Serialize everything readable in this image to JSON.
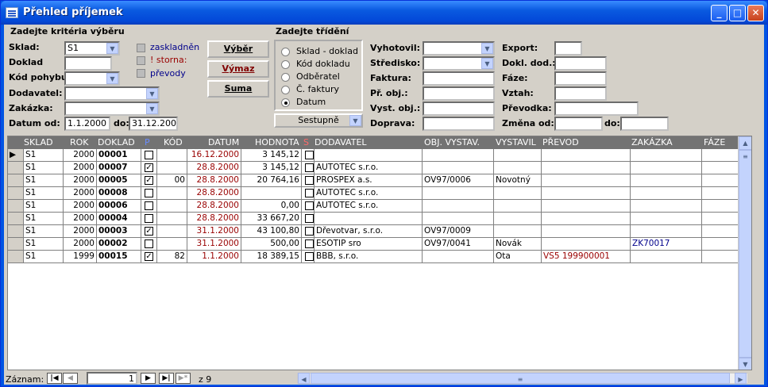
{
  "window": {
    "title": "Přehled příjemek"
  },
  "filter": {
    "group_title": "Zadejte kritéria výběru",
    "sklad_label": "Sklad:",
    "sklad_value": "S1",
    "doklad_label": "Doklad",
    "doklad_value": "",
    "kod_label": "Kód pohybu:",
    "kod_value": "",
    "dodavatel_label": "Dodavatel:",
    "dodavatel_value": "",
    "zakazka_label": "Zakázka:",
    "zakazka_value": "",
    "datum_label": "Datum od:",
    "datum_od": "1.1.2000",
    "do_label": "do:",
    "datum_do": "31.12.2000",
    "check_naskladnen": "zaskladněn",
    "check_storna": "! storna:",
    "check_prevody": "převody"
  },
  "buttons": {
    "vyber": "Výběr",
    "vymaz": "Výmaz",
    "suma": "Suma"
  },
  "sort": {
    "group_title": "Zadejte třídění",
    "options": [
      "Sklad - doklad",
      "Kód dokladu",
      "Odběratel",
      "Č. faktury",
      "Datum"
    ],
    "selected": 4,
    "direction": "Sestupně"
  },
  "filter2": {
    "vyhotovil": "Vyhotovil:",
    "stredisko": "Středisko:",
    "faktura": "Faktura:",
    "pr_obj": "Př. obj.:",
    "vyst_obj": "Vyst. obj.:",
    "doprava": "Doprava:",
    "export": "Export:",
    "dokl_dod": "Dokl. dod.:",
    "faze": "Fáze:",
    "vztah": "Vztah:",
    "prevodka": "Převodka:",
    "zmena_od": "Změna od:",
    "do": "do:"
  },
  "table": {
    "headers": [
      "SKLAD",
      "ROK",
      "DOKLAD",
      "P",
      "KÓD",
      "DATUM",
      "HODNOTA",
      "S",
      "DODAVATEL",
      "OBJ. VYSTAV.",
      "VYSTAVIL",
      "PŘEVOD",
      "ZAKÁZKA",
      "FÁZE"
    ],
    "rows": [
      {
        "sklad": "S1",
        "rok": "2000",
        "doklad": "00001",
        "p": "",
        "kod": "",
        "datum": "16.12.2000",
        "hodnota": "3 145,12",
        "s": "",
        "dodavatel": "",
        "obj": "",
        "vystavil": "",
        "prevod": "",
        "zakazka": "",
        "faze": ""
      },
      {
        "sklad": "S1",
        "rok": "2000",
        "doklad": "00007",
        "p": "✓",
        "kod": "",
        "datum": "28.8.2000",
        "hodnota": "3 145,12",
        "s": "",
        "dodavatel": "AUTOTEC s.r.o.",
        "obj": "",
        "vystavil": "",
        "prevod": "",
        "zakazka": "",
        "faze": ""
      },
      {
        "sklad": "S1",
        "rok": "2000",
        "doklad": "00005",
        "p": "✓",
        "kod": "00",
        "datum": "28.8.2000",
        "hodnota": "20 764,16",
        "s": "",
        "dodavatel": "PROSPEX a.s.",
        "obj": "OV97/0006",
        "vystavil": "Novotný",
        "prevod": "",
        "zakazka": "",
        "faze": ""
      },
      {
        "sklad": "S1",
        "rok": "2000",
        "doklad": "00008",
        "p": "",
        "kod": "",
        "datum": "28.8.2000",
        "hodnota": "",
        "s": "",
        "dodavatel": "AUTOTEC s.r.o.",
        "obj": "",
        "vystavil": "",
        "prevod": "",
        "zakazka": "",
        "faze": ""
      },
      {
        "sklad": "S1",
        "rok": "2000",
        "doklad": "00006",
        "p": "",
        "kod": "",
        "datum": "28.8.2000",
        "hodnota": "0,00",
        "s": "",
        "dodavatel": "AUTOTEC s.r.o.",
        "obj": "",
        "vystavil": "",
        "prevod": "",
        "zakazka": "",
        "faze": ""
      },
      {
        "sklad": "S1",
        "rok": "2000",
        "doklad": "00004",
        "p": "",
        "kod": "",
        "datum": "28.8.2000",
        "hodnota": "33 667,20",
        "s": "",
        "dodavatel": "",
        "obj": "",
        "vystavil": "",
        "prevod": "",
        "zakazka": "",
        "faze": ""
      },
      {
        "sklad": "S1",
        "rok": "2000",
        "doklad": "00003",
        "p": "✓",
        "kod": "",
        "datum": "31.1.2000",
        "hodnota": "43 100,80",
        "s": "",
        "dodavatel": "Dřevotvar, s.r.o.",
        "obj": "OV97/0009",
        "vystavil": "",
        "prevod": "",
        "zakazka": "",
        "faze": ""
      },
      {
        "sklad": "S1",
        "rok": "2000",
        "doklad": "00002",
        "p": "",
        "kod": "",
        "datum": "31.1.2000",
        "hodnota": "500,00",
        "s": "",
        "dodavatel": "ESOTIP sro",
        "obj": "OV97/0041",
        "vystavil": "Novák",
        "prevod": "",
        "zakazka": "ZK70017",
        "faze": ""
      },
      {
        "sklad": "S1",
        "rok": "1999",
        "doklad": "00015",
        "p": "✓",
        "kod": "82",
        "datum": "1.1.2000",
        "hodnota": "18 389,15",
        "s": "",
        "dodavatel": "BBB, s.r.o.",
        "obj": "",
        "vystavil": "Ota",
        "prevod": "VS5   199900001",
        "zakazka": "",
        "faze": ""
      }
    ]
  },
  "status": {
    "label": "Záznam:",
    "current": "1",
    "of": "z 9"
  }
}
